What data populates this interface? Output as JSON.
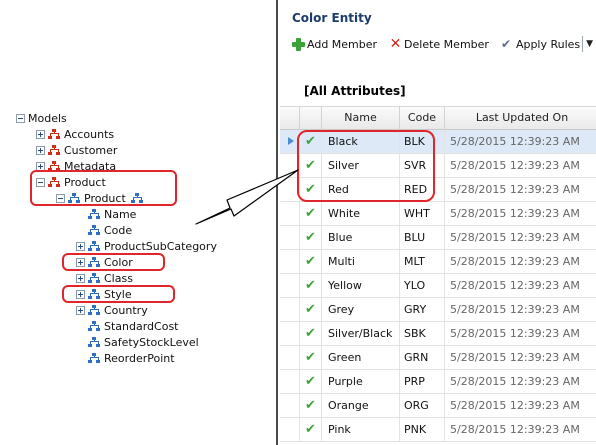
{
  "tree": {
    "nodes": [
      {
        "label": "Models",
        "toggle": "minus",
        "icon": "none"
      },
      {
        "label": "Accounts",
        "toggle": "plus",
        "icon": "red-hierarchy-icon"
      },
      {
        "label": "Customer",
        "toggle": "plus",
        "icon": "red-hierarchy-icon"
      },
      {
        "label": "Metadata",
        "toggle": "plus",
        "icon": "red-hierarchy-icon"
      },
      {
        "label": "Product",
        "toggle": "minus",
        "icon": "red-hierarchy-icon"
      },
      {
        "label": "Product",
        "toggle": "minus",
        "icon": "blue-hierarchy-icon"
      },
      {
        "label": "Name",
        "toggle": "none",
        "icon": "blue-hierarchy-icon"
      },
      {
        "label": "Code",
        "toggle": "none",
        "icon": "blue-hierarchy-icon"
      },
      {
        "label": "ProductSubCategory",
        "toggle": "plus",
        "icon": "blue-hierarchy-icon"
      },
      {
        "label": "Color",
        "toggle": "plus",
        "icon": "blue-hierarchy-icon"
      },
      {
        "label": "Class",
        "toggle": "plus",
        "icon": "blue-hierarchy-icon"
      },
      {
        "label": "Style",
        "toggle": "plus",
        "icon": "blue-hierarchy-icon"
      },
      {
        "label": "Country",
        "toggle": "plus",
        "icon": "blue-hierarchy-icon"
      },
      {
        "label": "StandardCost",
        "toggle": "none",
        "icon": "blue-hierarchy-icon"
      },
      {
        "label": "SafetyStockLevel",
        "toggle": "none",
        "icon": "blue-hierarchy-icon"
      },
      {
        "label": "ReorderPoint",
        "toggle": "none",
        "icon": "blue-hierarchy-icon"
      }
    ]
  },
  "panel": {
    "title": "Color Entity",
    "toolbar": {
      "add_label": "Add Member",
      "delete_label": "Delete Member",
      "rules_label": "Apply Rules"
    },
    "view_label": "[All Attributes]",
    "columns": [
      "Name",
      "Code",
      "Last Updated On"
    ],
    "rows": [
      {
        "name": "Black",
        "code": "BLK",
        "updated": "5/28/2015 12:39:23 AM"
      },
      {
        "name": "Silver",
        "code": "SVR",
        "updated": "5/28/2015 12:39:23 AM"
      },
      {
        "name": "Red",
        "code": "RED",
        "updated": "5/28/2015 12:39:23 AM"
      },
      {
        "name": "White",
        "code": "WHT",
        "updated": "5/28/2015 12:39:23 AM"
      },
      {
        "name": "Blue",
        "code": "BLU",
        "updated": "5/28/2015 12:39:23 AM"
      },
      {
        "name": "Multi",
        "code": "MLT",
        "updated": "5/28/2015 12:39:23 AM"
      },
      {
        "name": "Yellow",
        "code": "YLO",
        "updated": "5/28/2015 12:39:23 AM"
      },
      {
        "name": "Grey",
        "code": "GRY",
        "updated": "5/28/2015 12:39:23 AM"
      },
      {
        "name": "Silver/Black",
        "code": "SBK",
        "updated": "5/28/2015 12:39:23 AM"
      },
      {
        "name": "Green",
        "code": "GRN",
        "updated": "5/28/2015 12:39:23 AM"
      },
      {
        "name": "Purple",
        "code": "PRP",
        "updated": "5/28/2015 12:39:23 AM"
      },
      {
        "name": "Orange",
        "code": "ORG",
        "updated": "5/28/2015 12:39:23 AM"
      },
      {
        "name": "Pink",
        "code": "PNK",
        "updated": "5/28/2015 12:39:23 AM"
      }
    ]
  },
  "colors": {
    "annotation_red": "#e0262b",
    "valid_check_green": "#3ea43a",
    "title_blue": "#1d3b6b"
  }
}
